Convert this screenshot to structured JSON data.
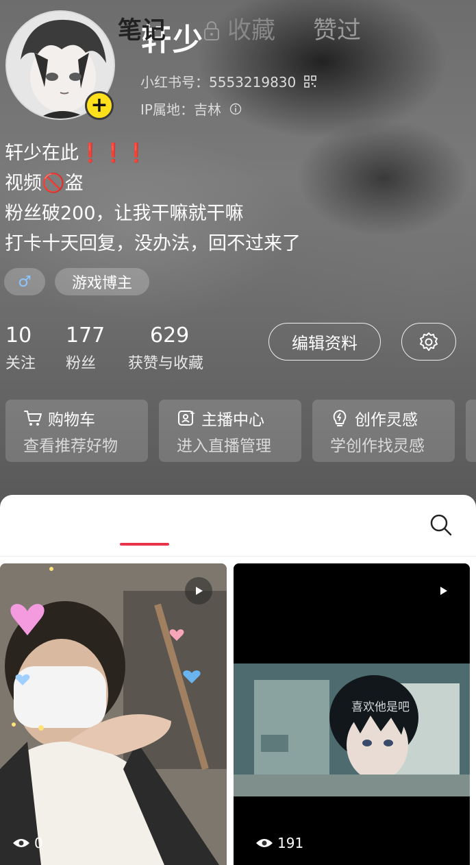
{
  "profile": {
    "nickname": "轩少",
    "redbook_id": "小红书号：5553219830",
    "ip_location": "IP属地：吉林",
    "bio": [
      "轩少在此❗❗❗",
      "视频🚫盗",
      "粉丝破200，让我干嘛就干嘛",
      "打卡十天回复，没办法，回不过来了"
    ],
    "tags": {
      "gender_symbol": "♂",
      "role": "游戏博主"
    }
  },
  "stats": [
    {
      "value": "10",
      "label": "关注"
    },
    {
      "value": "177",
      "label": "粉丝"
    },
    {
      "value": "629",
      "label": "获赞与收藏"
    }
  ],
  "actions": {
    "edit_profile": "编辑资料"
  },
  "cards": [
    {
      "title": "购物车",
      "subtitle": "查看推荐好物",
      "icon": "cart-icon"
    },
    {
      "title": "主播中心",
      "subtitle": "进入直播管理",
      "icon": "anchor-icon"
    },
    {
      "title": "创作灵感",
      "subtitle": "学创作找灵感",
      "icon": "bulb-icon"
    }
  ],
  "tabs": {
    "notes": "笔记",
    "favorites": "收藏",
    "liked": "赞过"
  },
  "posts": [
    {
      "views": "0",
      "caption": ""
    },
    {
      "views": "191",
      "caption": "喜欢他是吧"
    }
  ],
  "colors": {
    "accent": "#e8334a",
    "badge": "#ffe01a"
  }
}
